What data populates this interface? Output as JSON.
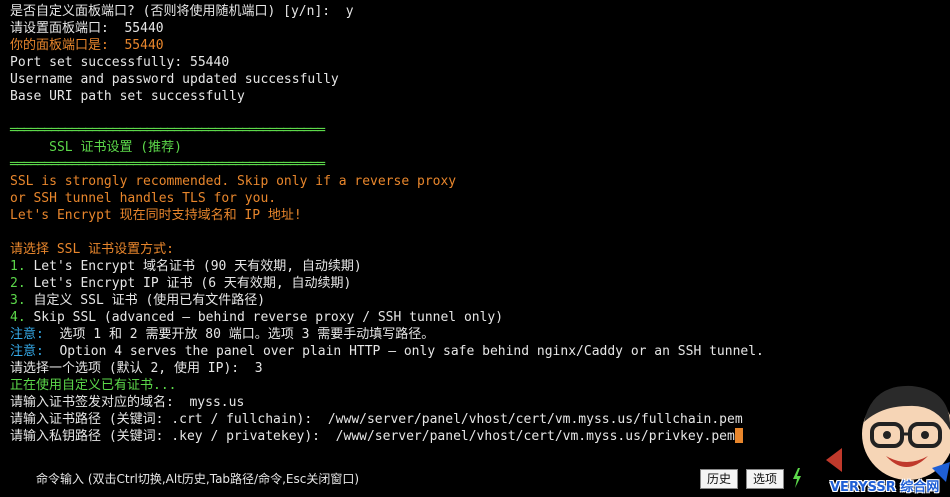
{
  "terminal": {
    "lines": [
      {
        "segments": [
          {
            "text": "是否自定义面板端口? (否则将使用随机端口) [y/n]:  y",
            "color": "white"
          }
        ]
      },
      {
        "segments": [
          {
            "text": "请设置面板端口:  55440",
            "color": "white"
          }
        ]
      },
      {
        "segments": [
          {
            "text": "你的面板端口是:  55440",
            "color": "orange"
          }
        ]
      },
      {
        "segments": [
          {
            "text": "Port set successfully: 55440",
            "color": "white"
          }
        ]
      },
      {
        "segments": [
          {
            "text": "Username and password updated successfully",
            "color": "white"
          }
        ]
      },
      {
        "segments": [
          {
            "text": "Base URI path set successfully",
            "color": "white"
          }
        ]
      },
      {
        "segments": [
          {
            "text": "",
            "color": "white"
          }
        ]
      },
      {
        "segments": [
          {
            "text": "══════════════════════════════════════════════",
            "color": "rule"
          }
        ]
      },
      {
        "segments": [
          {
            "text": "     SSL 证书设置 (推荐)",
            "color": "green"
          }
        ]
      },
      {
        "segments": [
          {
            "text": "══════════════════════════════════════════════",
            "color": "rule"
          }
        ]
      },
      {
        "segments": [
          {
            "text": "SSL is strongly recommended. Skip only if a reverse proxy",
            "color": "orange"
          }
        ]
      },
      {
        "segments": [
          {
            "text": "or SSH tunnel handles TLS for you.",
            "color": "orange"
          }
        ]
      },
      {
        "segments": [
          {
            "text": "Let's Encrypt 现在同时支持域名和 IP 地址!",
            "color": "orange"
          }
        ]
      },
      {
        "segments": [
          {
            "text": "",
            "color": "white"
          }
        ]
      },
      {
        "segments": [
          {
            "text": "请选择 SSL 证书设置方式:",
            "color": "orange"
          }
        ]
      },
      {
        "segments": [
          {
            "text": "1.",
            "color": "green"
          },
          {
            "text": " Let's Encrypt 域名证书 (90 天有效期, 自动续期)",
            "color": "white"
          }
        ]
      },
      {
        "segments": [
          {
            "text": "2.",
            "color": "green"
          },
          {
            "text": " Let's Encrypt IP 证书 (6 天有效期, 自动续期)",
            "color": "white"
          }
        ]
      },
      {
        "segments": [
          {
            "text": "3.",
            "color": "green"
          },
          {
            "text": " 自定义 SSL 证书 (使用已有文件路径)",
            "color": "white"
          }
        ]
      },
      {
        "segments": [
          {
            "text": "4.",
            "color": "green"
          },
          {
            "text": " Skip SSL (advanced — behind reverse proxy / SSH tunnel only)",
            "color": "white"
          }
        ]
      },
      {
        "segments": [
          {
            "text": "注意:",
            "color": "cyan"
          },
          {
            "text": "  选项 1 和 2 需要开放 80 端口。选项 3 需要手动填写路径。",
            "color": "white"
          }
        ]
      },
      {
        "segments": [
          {
            "text": "注意:",
            "color": "cyan"
          },
          {
            "text": "  Option 4 serves the panel over plain HTTP — only safe behind nginx/Caddy or an SSH tunnel.",
            "color": "white"
          }
        ]
      },
      {
        "segments": [
          {
            "text": "请选择一个选项 (默认 2, 使用 IP):  3",
            "color": "white"
          }
        ]
      },
      {
        "segments": [
          {
            "text": "正在使用自定义已有证书...",
            "color": "green"
          }
        ]
      },
      {
        "segments": [
          {
            "text": "请输入证书签发对应的域名:  myss.us",
            "color": "white"
          }
        ]
      },
      {
        "segments": [
          {
            "text": "请输入证书路径 (关键词: .crt / fullchain):  /www/server/panel/vhost/cert/vm.myss.us/fullchain.pem",
            "color": "white"
          }
        ]
      },
      {
        "segments": [
          {
            "text": "请输入私钥路径 (关键词: .key / privatekey):  /www/server/panel/vhost/cert/vm.myss.us/privkey.pem",
            "color": "white"
          }
        ],
        "cursor": true
      }
    ]
  },
  "command_bar": {
    "hint": "命令输入 (双击Ctrl切换,Alt历史,Tab路径/命令,Esc关闭窗口)",
    "history_label": "历史",
    "options_label": "选项",
    "bolt_icon": "lightning-bolt-icon"
  },
  "watermark": {
    "text": "VERYSSR 综合网"
  },
  "colors": {
    "background": "#000000",
    "text": "#e6e6e6",
    "orange": "#e8862c",
    "green": "#5cd84a",
    "cyan": "#35a8e6"
  }
}
